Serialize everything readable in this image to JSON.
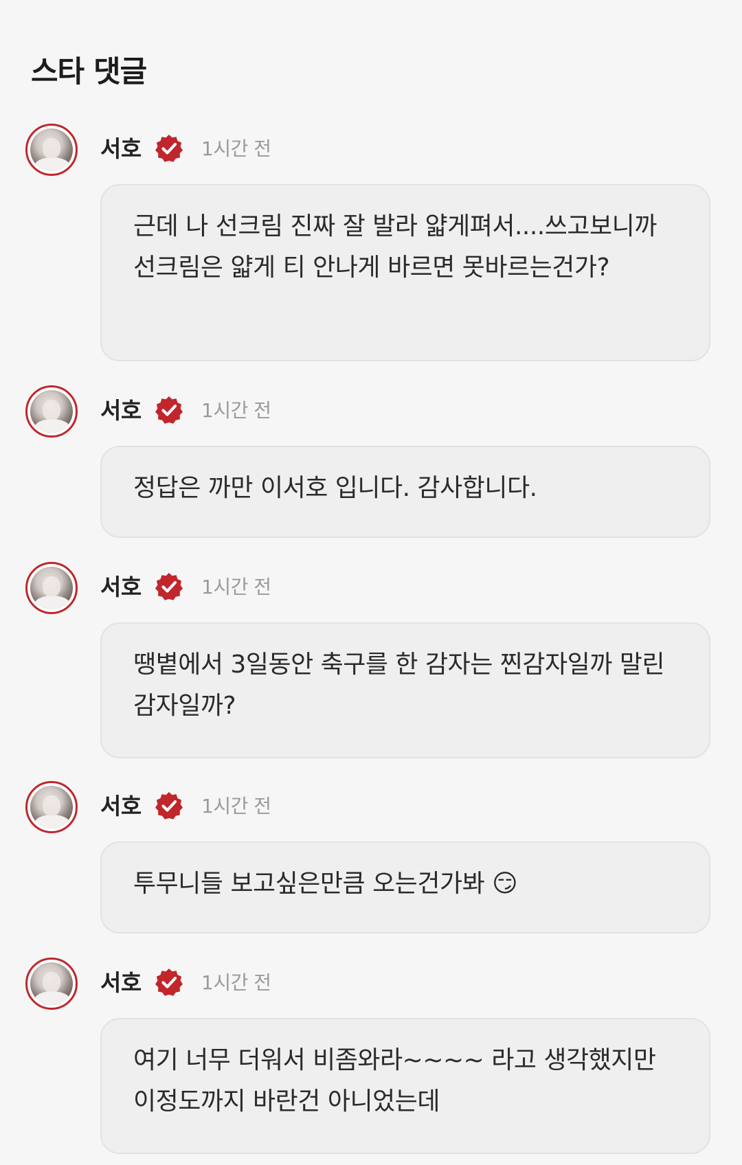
{
  "page": {
    "section_title": "스타 댓글"
  },
  "comments": [
    {
      "author": "서호",
      "verified": true,
      "time": "1시간 전",
      "text": "근데 나 선크림 진짜 잘 발라 얇게펴서....쓰고보니까 선크림은 얇게 티 안나게 바르면 못바르는건가?"
    },
    {
      "author": "서호",
      "verified": true,
      "time": "1시간 전",
      "text": "정답은 까만 이서호 입니다. 감사합니다."
    },
    {
      "author": "서호",
      "verified": true,
      "time": "1시간 전",
      "text": "땡볕에서 3일동안 축구를 한 감자는 찐감자일까 말린감자일까?"
    },
    {
      "author": "서호",
      "verified": true,
      "time": "1시간 전",
      "text": "투무니들 보고싶은만큼 오는건가봐 😏"
    },
    {
      "author": "서호",
      "verified": true,
      "time": "1시간 전",
      "text": "여기 너무 더워서 비좀와라~~~~ 라고 생각했지만 이정도까지 바란건 아니었는데"
    }
  ],
  "colors": {
    "background": "#f6f6f6",
    "bubble": "#efefef",
    "accent": "#c0262c",
    "timestamp": "#9a9a9a"
  },
  "icons": {
    "badge": "verified-check-icon"
  }
}
